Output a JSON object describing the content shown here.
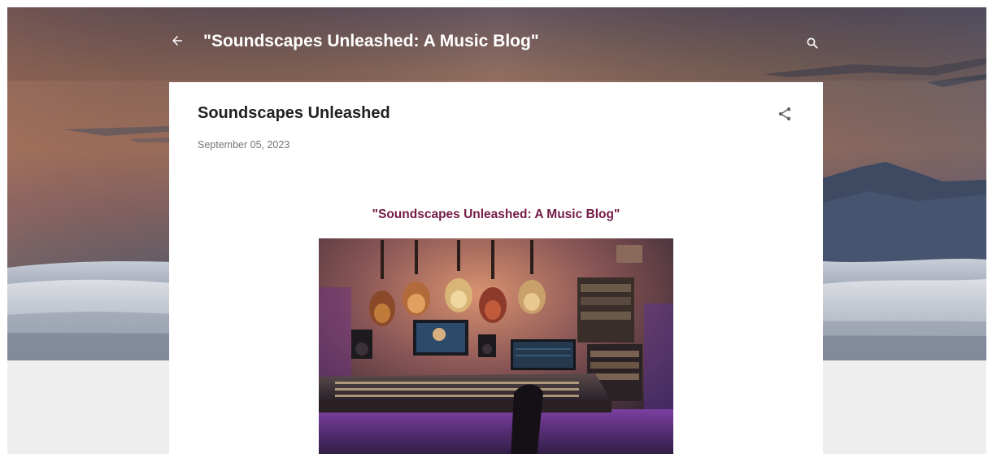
{
  "header": {
    "back_icon": "arrow-left-icon",
    "blog_title": "\"Soundscapes Unleashed: A Music Blog\"",
    "search_icon": "search-icon"
  },
  "post": {
    "title": "Soundscapes Unleashed",
    "date": "September 05, 2023",
    "share_icon": "share-icon",
    "heading": "\"Soundscapes Unleashed: A Music Blog\"",
    "heading_color": "#741b47",
    "image_icon": "recording-studio-photo"
  },
  "colors": {
    "page_background": "#eeeeee",
    "card_background": "#ffffff",
    "title_text": "#212121",
    "date_text": "#757575",
    "header_text": "#ffffff"
  }
}
